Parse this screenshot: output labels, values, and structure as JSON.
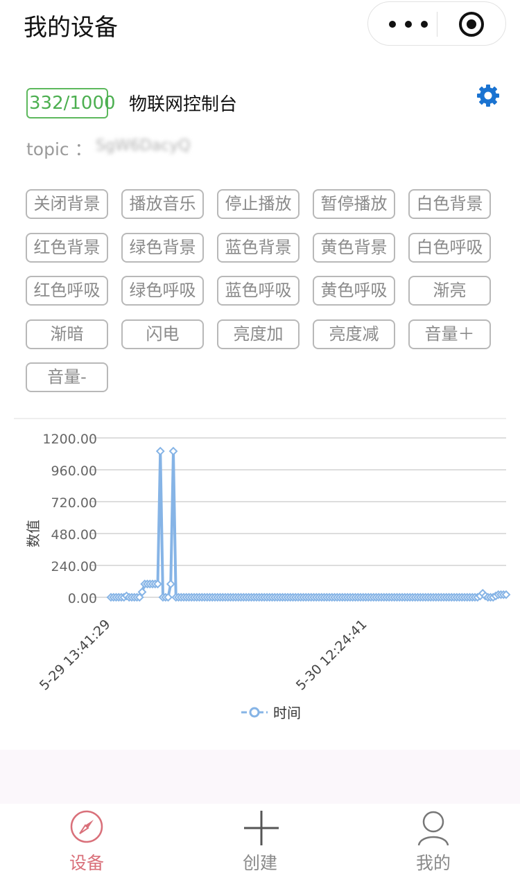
{
  "header": {
    "title": "我的设备"
  },
  "device": {
    "counter": "332/1000",
    "name": "物联网控制台",
    "topic_label": "topic ：",
    "topic_value": "SgW6DacyQ"
  },
  "commands": [
    "关闭背景",
    "播放音乐",
    "停止播放",
    "暂停播放",
    "白色背景",
    "红色背景",
    "绿色背景",
    "蓝色背景",
    "黄色背景",
    "白色呼吸",
    "红色呼吸",
    "绿色呼吸",
    "蓝色呼吸",
    "黄色呼吸",
    "渐亮",
    "渐暗",
    "闪电",
    "亮度加",
    "亮度减",
    "音量＋",
    "音量-"
  ],
  "chart_data": {
    "type": "line",
    "ylabel": "数值",
    "yticks": [
      "1200.00",
      "960.00",
      "720.00",
      "480.00",
      "240.00",
      "0.00"
    ],
    "ylim": [
      0,
      1200
    ],
    "xticks": [
      "5-29 13:41:29",
      "5-30 12:24:41"
    ],
    "legend": "时间",
    "legend_position": "bottom-center",
    "color": "#86b4e6",
    "series": [
      {
        "values": [
          0,
          0,
          0,
          0,
          0,
          0,
          10,
          0,
          0,
          0,
          0,
          0,
          40,
          100,
          100,
          100,
          100,
          100,
          100,
          1100,
          0,
          0,
          0,
          100,
          1100,
          0,
          0,
          0,
          0,
          0,
          0,
          0,
          0,
          0,
          0,
          0,
          0,
          0,
          0,
          0,
          0,
          0,
          0,
          0,
          0,
          0,
          0,
          0,
          0,
          0,
          0,
          0,
          0,
          0,
          0,
          0,
          0,
          0,
          0,
          0,
          0,
          0,
          0,
          0,
          0,
          0,
          0,
          0,
          0,
          0,
          0,
          0,
          0,
          0,
          0,
          0,
          0,
          0,
          0,
          0,
          0,
          0,
          0,
          0,
          0,
          0,
          0,
          0,
          0,
          0,
          0,
          0,
          0,
          0,
          0,
          0,
          0,
          0,
          0,
          0,
          0,
          0,
          0,
          0,
          0,
          0,
          0,
          0,
          0,
          0,
          0,
          0,
          0,
          0,
          0,
          0,
          0,
          0,
          0,
          0,
          0,
          0,
          0,
          0,
          0,
          0,
          0,
          0,
          0,
          0,
          0,
          0,
          0,
          0,
          0,
          0,
          0,
          0,
          0,
          0,
          0,
          0,
          10,
          30,
          10,
          0,
          0,
          0,
          10,
          20,
          20,
          20,
          20
        ]
      }
    ]
  },
  "tabbar": {
    "tabs": [
      {
        "label": "设备",
        "icon": "compass-icon",
        "active": true
      },
      {
        "label": "创建",
        "icon": "plus-icon",
        "active": false
      },
      {
        "label": "我的",
        "icon": "user-icon",
        "active": false
      }
    ],
    "active_color": "#d9707a",
    "inactive_color": "#8a8a8a"
  }
}
